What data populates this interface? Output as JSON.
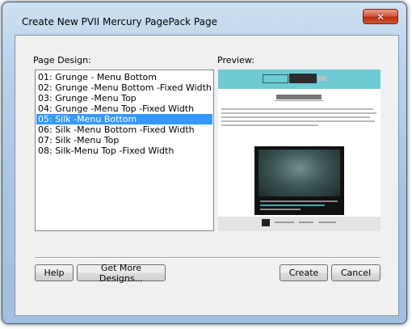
{
  "window": {
    "title": "Create New PVII Mercury PagePack Page"
  },
  "title_bar": {
    "close_glyph": "✕"
  },
  "page_design": {
    "label": "Page Design:",
    "selected_index": 4,
    "items": [
      "01: Grunge - Menu Bottom",
      "02: Grunge -Menu Bottom -Fixed Width",
      "03: Grunge -Menu Top",
      "04: Grunge -Menu Top -Fixed Width",
      "05: Silk -Menu Bottom",
      "06: Silk -Menu Bottom -Fixed Width",
      "07: Silk -Menu Top",
      "08: Silk-Menu Top -Fixed Width"
    ]
  },
  "preview": {
    "label": "Preview:"
  },
  "buttons": {
    "help": "Help",
    "get_more": "Get More Designs...",
    "create": "Create",
    "cancel": "Cancel"
  },
  "colors": {
    "selection": "#3399ff",
    "preview_header": "#6fcbd3",
    "close_button": "#c7411f"
  }
}
